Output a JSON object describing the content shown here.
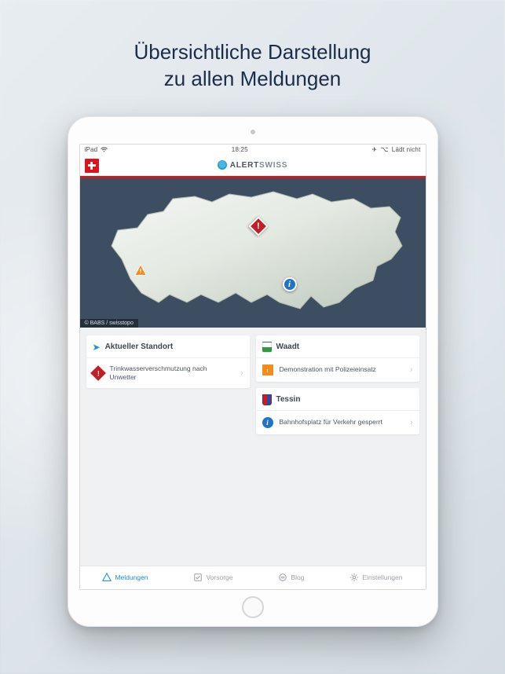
{
  "page_title_line1": "Übersichtliche Darstellung",
  "page_title_line2": "zu allen Meldungen",
  "status": {
    "left": "iPad",
    "time": "18:25",
    "right": "Lädt nicht"
  },
  "brand": {
    "prefix": "ALERT",
    "suffix": "SWISS"
  },
  "map": {
    "attribution": "© BABS / swisstopo",
    "markers": {
      "red": "!",
      "orange": "!",
      "blue": "i"
    }
  },
  "cols": {
    "left": {
      "head": "Aktueller Standort",
      "item": "Trinkwasserverschmutzung nach Unwetter"
    },
    "right": {
      "c1_head": "Waadt",
      "c1_item": "Demonstration mit Polizeieinsatz",
      "c2_head": "Tessin",
      "c2_item": "Bahnhofsplatz für Verkehr gesperrt"
    }
  },
  "tabs": {
    "t1": "Meldungen",
    "t2": "Vorsorge",
    "t3": "Blog",
    "t4": "Einstellungen"
  }
}
